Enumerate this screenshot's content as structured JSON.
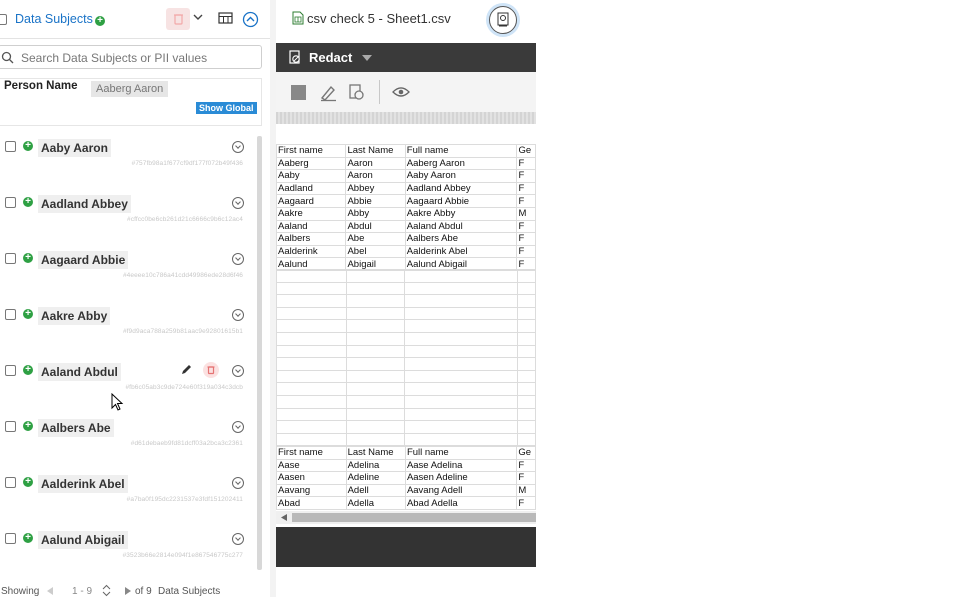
{
  "left_panel": {
    "title": "Data Subjects",
    "search_placeholder": "Search Data Subjects or PII values",
    "person_name_label": "Person Name",
    "selected_name": "Aaberg Aaron",
    "show_global_label": "Show Global",
    "rows": [
      {
        "name": "Aaby Aaron",
        "id": "#757fb98a1f677cf9df177f072b49f436"
      },
      {
        "name": "Aadland Abbey",
        "id": "#cffcc0be6cb261d21c6666c9b6c12ac4"
      },
      {
        "name": "Aagaard Abbie",
        "id": "#4eeee10c786a41cdd49986ede28d6f46"
      },
      {
        "name": "Aakre Abby",
        "id": "#f9d9aca788a259b81aac9e92801615b1"
      },
      {
        "name": "Aaland Abdul",
        "id": "#fb6c05ab3c9de724e60f319a034c3dcb"
      },
      {
        "name": "Aalbers Abe",
        "id": "#d61debaeb9fd81dcff03a2bca3c2361"
      },
      {
        "name": "Aalderink Abel",
        "id": "#a7ba0f195dc2231537e3fdf151202411"
      },
      {
        "name": "Aalund Abigail",
        "id": "#3523b66e2814e094f1e867546775c277"
      }
    ],
    "footer": {
      "showing": "Showing",
      "range": "1 - 9",
      "of": "of 9",
      "subjects": "Data Subjects"
    }
  },
  "right_panel": {
    "file_title": "csv check 5 - Sheet1.csv",
    "redact_label": "Redact",
    "table1": {
      "headers": [
        "First name",
        "Last Name",
        "Full name",
        "Ge"
      ],
      "rows": [
        [
          "Aaberg",
          "Aaron",
          "Aaberg Aaron",
          "F"
        ],
        [
          "Aaby",
          "Aaron",
          "Aaby Aaron",
          "F"
        ],
        [
          "Aadland",
          "Abbey",
          "Aadland Abbey",
          "F"
        ],
        [
          "Aagaard",
          "Abbie",
          "Aagaard Abbie",
          "F"
        ],
        [
          "Aakre",
          "Abby",
          "Aakre Abby",
          "M"
        ],
        [
          "Aaland",
          "Abdul",
          "Aaland Abdul",
          "F"
        ],
        [
          "Aalbers",
          "Abe",
          "Aalbers Abe",
          "F"
        ],
        [
          "Aalderink",
          "Abel",
          "Aalderink Abel",
          "F"
        ],
        [
          "Aalund",
          "Abigail",
          "Aalund Abigail",
          "F"
        ]
      ]
    },
    "table2": {
      "headers": [
        "First name",
        "Last Name",
        "Full name",
        "Ge"
      ],
      "rows": [
        [
          "Aase",
          "Adelina",
          "Aase Adelina",
          "F"
        ],
        [
          "Aasen",
          "Adeline",
          "Aasen Adeline",
          "F"
        ],
        [
          "Aavang",
          "Adell",
          "Aavang Adell",
          "M"
        ],
        [
          "Abad",
          "Adella",
          "Abad Adella",
          "F"
        ]
      ]
    }
  },
  "colors": {
    "accent": "#1a73c7",
    "add_green": "#2ea043",
    "delete_red": "#e57373",
    "dark_bar": "#3a3a3a"
  }
}
